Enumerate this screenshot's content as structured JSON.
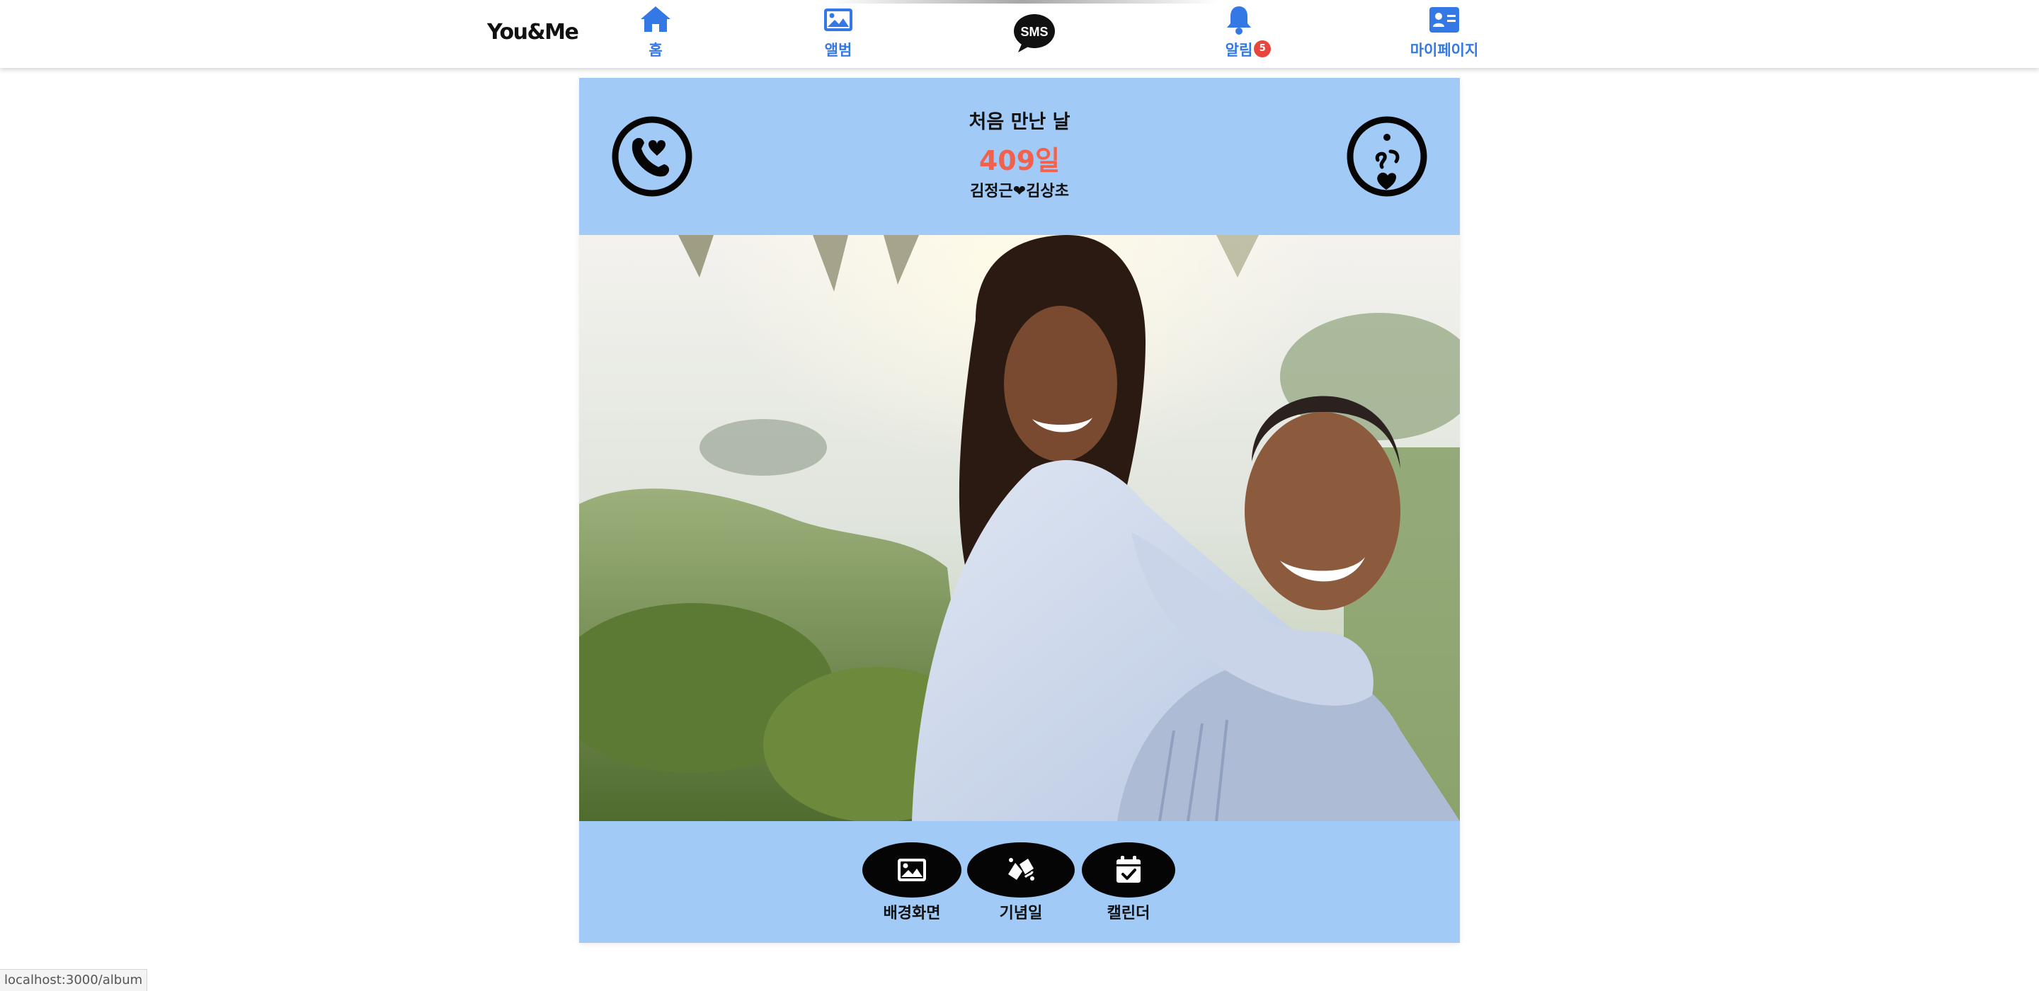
{
  "nav": {
    "brand": "You&Me",
    "items": [
      {
        "label": "홈",
        "icon": "home-icon"
      },
      {
        "label": "앨범",
        "icon": "image-icon"
      },
      {
        "label": "SMS",
        "icon": "sms-bubble-icon"
      },
      {
        "label": "알림",
        "icon": "bell-icon",
        "badge": "5"
      },
      {
        "label": "마이페이지",
        "icon": "id-card-icon"
      }
    ],
    "accent_color": "#3478e5",
    "badge_color": "#e8453c"
  },
  "header": {
    "title": "처음 만난 날",
    "day_count": "409일",
    "couple": "김정근❤김상초",
    "left_icon": "heart-phone-icon",
    "right_icon": "kiss-face-icon",
    "background_color": "#a1cbf6",
    "count_color": "#f2604e"
  },
  "photo": {
    "icon": "couple-photo"
  },
  "actions": [
    {
      "label": "배경화면",
      "icon": "image-icon"
    },
    {
      "label": "기념일",
      "icon": "celebration-icon"
    },
    {
      "label": "캘린더",
      "icon": "calendar-check-icon"
    }
  ],
  "status_url": "localhost:3000/album"
}
